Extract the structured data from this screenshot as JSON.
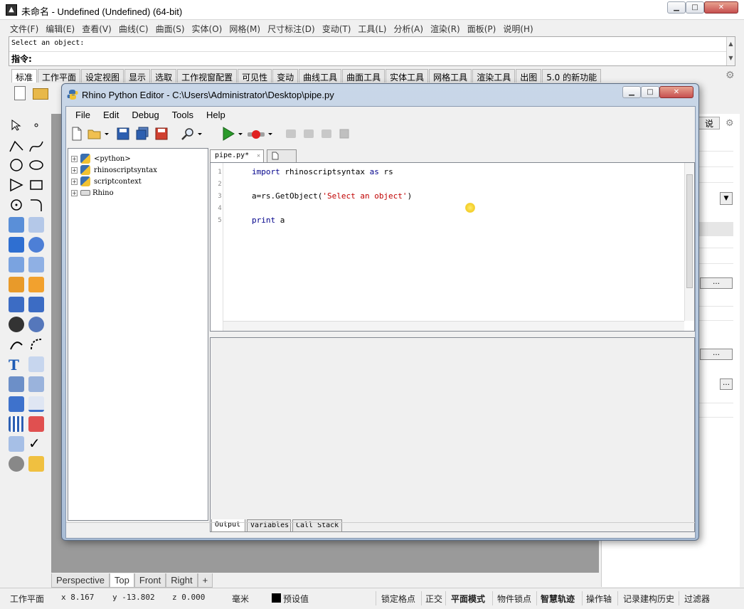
{
  "window": {
    "title": "未命名 - Undefined (Undefined) (64-bit)",
    "minimize": "▁",
    "maximize": "□",
    "close": "✕"
  },
  "menu": [
    "文件(F)",
    "编辑(E)",
    "查看(V)",
    "曲线(C)",
    "曲面(S)",
    "实体(O)",
    "网格(M)",
    "尺寸标注(D)",
    "变动(T)",
    "工具(L)",
    "分析(A)",
    "渲染(R)",
    "面板(P)",
    "说明(H)"
  ],
  "command": {
    "history": "Select an object:",
    "prompt": "指令:"
  },
  "toolbar_tabs": [
    "标准",
    "工作平面",
    "设定视图",
    "显示",
    "选取",
    "工作视窗配置",
    "可见性",
    "变动",
    "曲线工具",
    "曲面工具",
    "实体工具",
    "网格工具",
    "渲染工具",
    "出图",
    "5.0 的新功能"
  ],
  "viewport_tabs": [
    "Perspective",
    "Top",
    "Front",
    "Right"
  ],
  "viewport_add": "+",
  "right_panel": {
    "tab": "说"
  },
  "status_bar": {
    "cplane": "工作平面",
    "x": "x 8.167",
    "y": "y -13.802",
    "z": "z 0.000",
    "units": "毫米",
    "layer": "预设值",
    "toggles": [
      "锁定格点",
      "正交",
      "平面模式",
      "物件锁点",
      "智慧轨迹",
      "操作轴",
      "记录建构历史",
      "过滤器"
    ]
  },
  "editor": {
    "title": "Rhino Python Editor - C:\\Users\\Administrator\\Desktop\\pipe.py",
    "menu": [
      "File",
      "Edit",
      "Debug",
      "Tools",
      "Help"
    ],
    "tree": [
      "<python>",
      "rhinoscriptsyntax",
      "scriptcontext",
      "Rhino"
    ],
    "doc_tab": "pipe.py*",
    "doc_tab_close": "✕",
    "line_numbers": [
      "1",
      "2",
      "3",
      "4",
      "5"
    ],
    "code": {
      "l1_kw": "import",
      "l1_mod": " rhinoscriptsyntax ",
      "l1_as": "as",
      "l1_alias": " rs",
      "l3_pre": "a=rs.GetObject(",
      "l3_str": "'Select an object'",
      "l3_post": ")",
      "l5_kw": "print",
      "l5_rest": " a"
    },
    "output_tabs": [
      "Output",
      "Variables",
      "Call Stack"
    ]
  }
}
